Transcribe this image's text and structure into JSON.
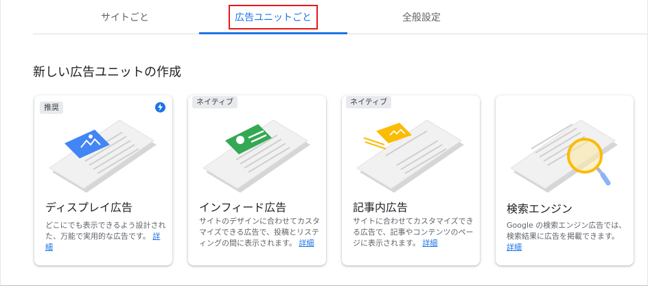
{
  "tabs": [
    {
      "label": "サイトごと"
    },
    {
      "label": "広告ユニットごと"
    },
    {
      "label": "全般設定"
    }
  ],
  "section_title": "新しい広告ユニットの作成",
  "cards": [
    {
      "badge": "推奨",
      "title": "ディスプレイ広告",
      "desc": "どこにでも表示できるよう設計された、万能で実用的な広告です。",
      "link": "詳細",
      "icon": "bolt-icon",
      "accent": "#4285f4"
    },
    {
      "badge": "ネイティブ",
      "title": "インフィード広告",
      "desc": "サイトのデザインに合わせてカスタマイズできる広告で、投稿とリスティングの間に表示されます。",
      "link": "詳細",
      "accent": "#34a853"
    },
    {
      "badge": "ネイティブ",
      "title": "記事内広告",
      "desc": "サイトに合わせてカスタマイズできる広告で、記事やコンテンツのページに表示されます。",
      "link": "詳細",
      "accent": "#fbbc04"
    },
    {
      "title": "検索エンジン",
      "desc": "Google の検索エンジン広告では、検索結果に広告を掲載できます。",
      "link": "詳細",
      "accent": "#fbbc04"
    }
  ],
  "colors": {
    "active_tab": "#1a73e8",
    "highlight_box": "#e8141b"
  }
}
